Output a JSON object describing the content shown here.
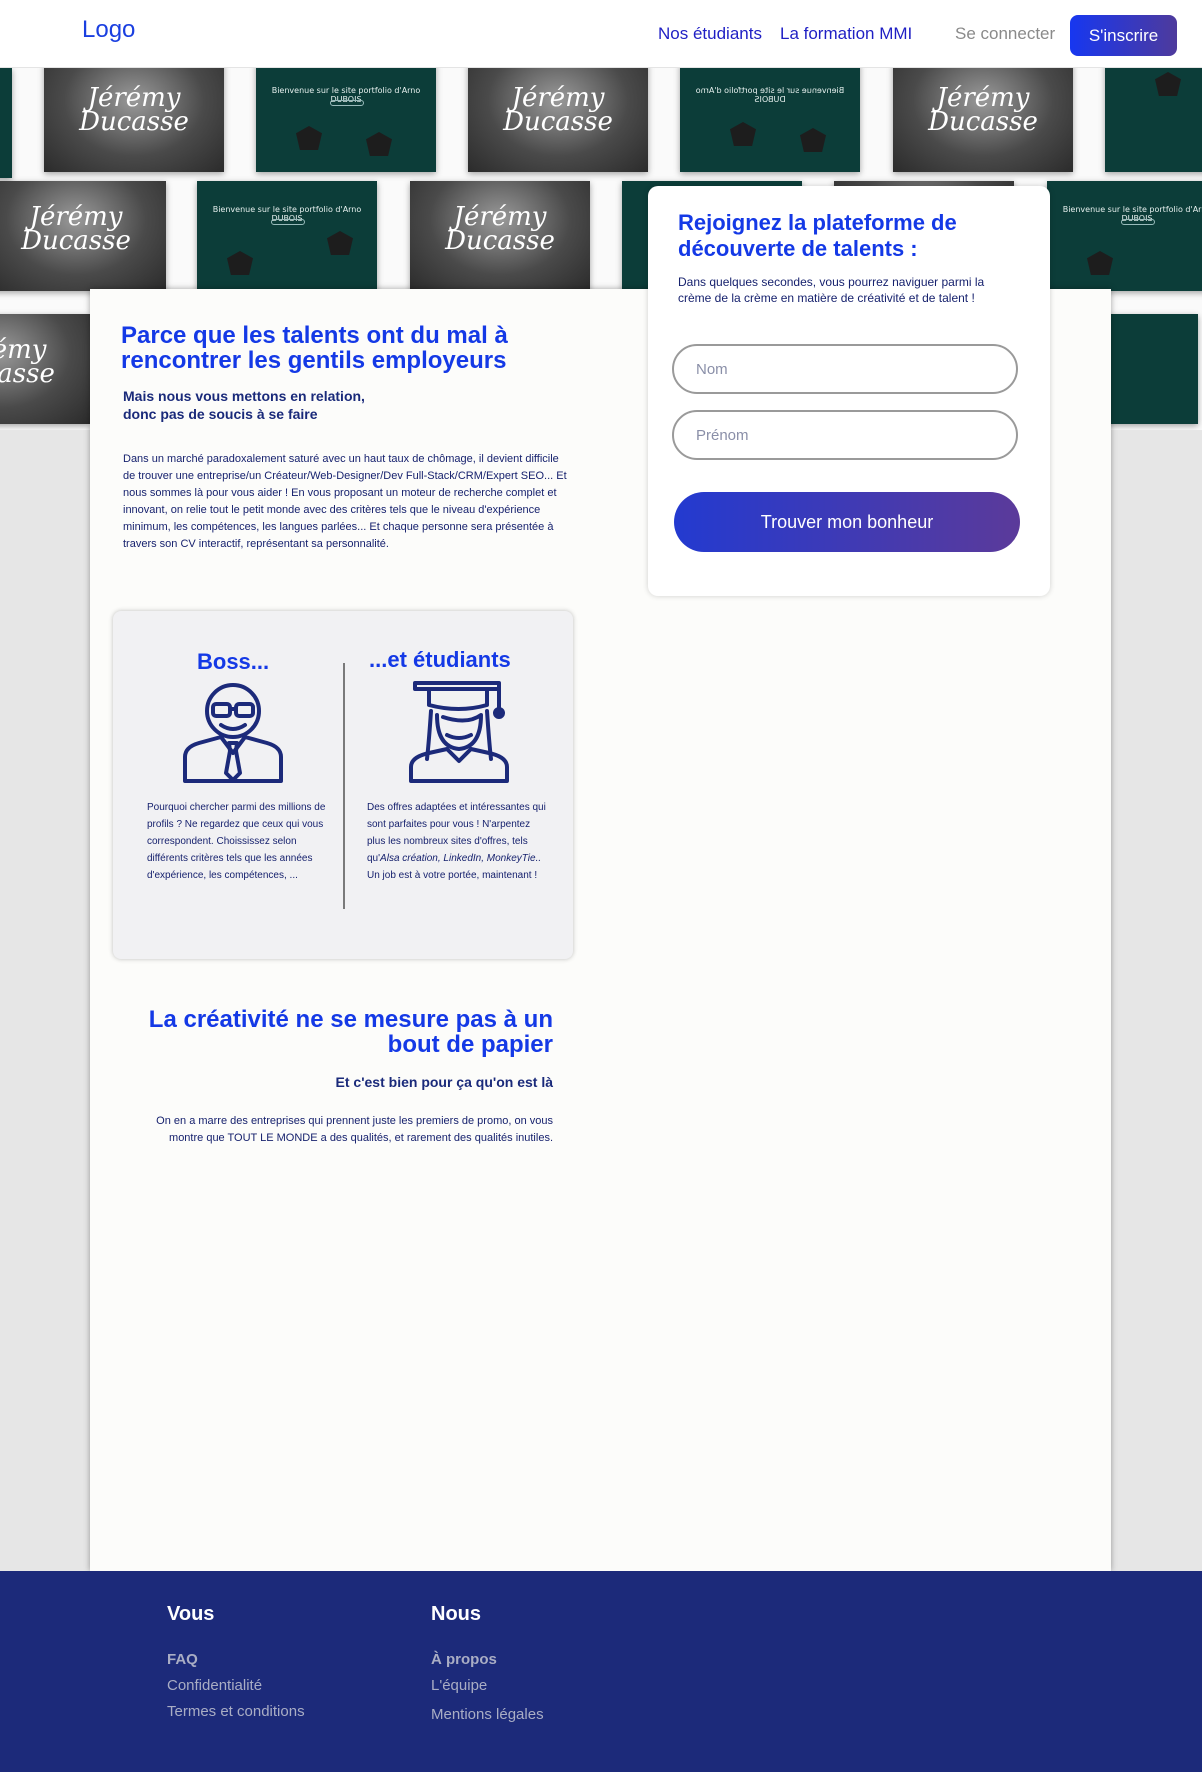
{
  "nav": {
    "logo": "Logo",
    "links": [
      "Nos étudiants",
      "La formation MMI"
    ],
    "login": "Se connecter",
    "signup": "S'inscrire"
  },
  "thumbnails": {
    "portrait_signature": "Jérémy Ducasse",
    "portfolio_title": "Bienvenue sur le site portfolio d'Arno DUBOIS"
  },
  "intro": {
    "title": "Parce que les talents ont du mal à rencontrer les gentils employeurs",
    "subtitle_line1": "Mais nous vous mettons en relation,",
    "subtitle_line2": "donc pas de soucis à se faire",
    "paragraph": "Dans un marché paradoxalement saturé avec un haut taux de chômage, il devient difficile de trouver une entreprise/un Créateur/Web-Designer/Dev Full-Stack/CRM/Expert SEO... Et nous sommes là pour vous aider ! En vous proposant un moteur de recherche complet et innovant, on relie tout le petit monde avec des critères tels que le niveau d'expérience minimum, les compétences, les langues parlées... Et chaque personne sera présentée à travers son CV interactif, représentant sa personnalité."
  },
  "dual": {
    "boss_title": "Boss...",
    "boss_text": "Pourquoi chercher parmi des millions de profils ? Ne regardez que ceux qui vous correspondent. Choississez selon différents critères tels que les années d'expérience, les compétences, ...",
    "students_title": "...et étudiants",
    "students_text_before": "Des offres adaptées et intéressantes qui sont parfaites pour vous ! N'arpentez plus les nombreux sites d'offres, tels qu'",
    "students_text_italic": "Alsa création, LinkedIn, MonkeyTie..",
    "students_text_after": " Un job est à votre portée, maintenant !"
  },
  "creativity": {
    "title": "La créativité ne se mesure pas à un bout de papier",
    "subtitle": "Et c'est bien pour ça qu'on est là",
    "paragraph": "On en a marre des entreprises qui prennent juste les premiers de promo, on vous montre que TOUT LE MONDE a des qualités, et rarement des qualités inutiles."
  },
  "signup": {
    "title": "Rejoignez la plateforme de découverte de talents :",
    "description": "Dans quelques secondes, vous pourrez naviguer parmi la crème de la crème en matière de créativité et de talent !",
    "name_placeholder": "Nom",
    "firstname_placeholder": "Prénom",
    "cta": "Trouver mon bonheur"
  },
  "footer": {
    "col1_title": "Vous",
    "col1_links": [
      "FAQ",
      "Confidentialité",
      "Termes et conditions"
    ],
    "col2_title": "Nous",
    "col2_links": [
      "À propos",
      "L'équipe",
      "Mentions légales"
    ]
  },
  "colors": {
    "accent": "#1439e6",
    "navy": "#1c2a7a",
    "gradient_start": "#233ad0",
    "gradient_end": "#5b3a9a"
  }
}
